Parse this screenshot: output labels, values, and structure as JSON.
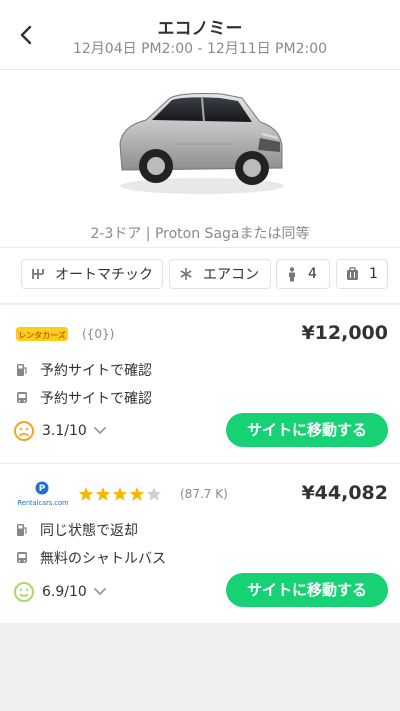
{
  "header": {
    "title": "エコノミー",
    "dates": "12月04日 PM2:00 - 12月11日 PM2:00"
  },
  "car": {
    "name": "2-3ドア | Proton Sagaまたは同等"
  },
  "features": {
    "transmission": "オートマチック",
    "aircon": "エアコン",
    "seats": "4",
    "bags": "1"
  },
  "offers": [
    {
      "provider_logo_text": "レンタカーズ",
      "reviews": "({0})",
      "price": "¥12,000",
      "fuel_policy": "予約サイトで確認",
      "shuttle": "予約サイトで確認",
      "score": "3.1/10",
      "button": "サイトに移動する",
      "face": "sad"
    },
    {
      "provider_logo_text": "Rentalcars.com",
      "rating_stars": 4,
      "reviews": "(87.7 K)",
      "price": "¥44,082",
      "fuel_policy": "同じ状態で返却",
      "shuttle": "無料のシャトルバス",
      "score": "6.9/10",
      "button": "サイトに移動する",
      "face": "neutral"
    }
  ],
  "colors": {
    "accent": "#17d275",
    "sad_face": "#f5a623",
    "neutral_face": "#a6d96a",
    "star": "#f5b800"
  }
}
